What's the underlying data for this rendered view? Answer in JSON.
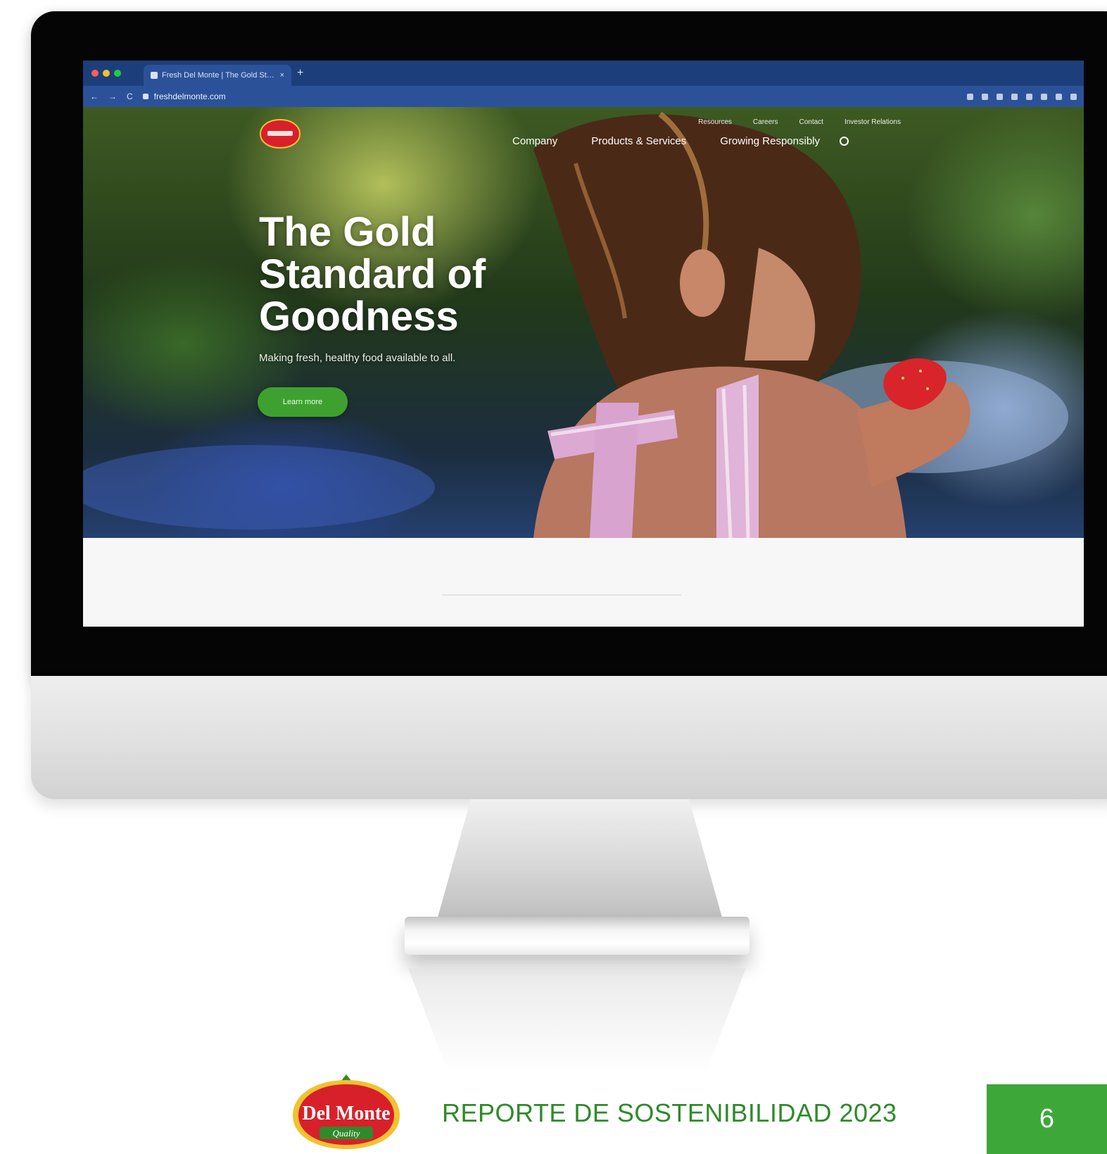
{
  "browser": {
    "tab_title": "Fresh Del Monte | The Gold Standard",
    "tab_close": "×",
    "new_tab": "+",
    "url": "freshdelmonte.com",
    "back": "←",
    "forward": "→",
    "reload": "C"
  },
  "site": {
    "utility_nav": [
      "Resources",
      "Careers",
      "Contact",
      "Investor Relations"
    ],
    "main_nav": [
      "Company",
      "Products & Services",
      "Growing Responsibly"
    ],
    "hero": {
      "title": "The Gold Standard of Goodness",
      "subtitle": "Making fresh, healthy food available to all.",
      "cta_label": "Learn more"
    }
  },
  "footer": {
    "logo": {
      "wordmark": "Del Monte",
      "tagline": "Quality"
    },
    "report_title": "REPORTE DE SOSTENIBILIDAD 2023",
    "page_number": "6"
  },
  "colors": {
    "browser_chrome": "#1c3f7c",
    "brand_green": "#3ea73a",
    "report_title_green": "#2f8a2a",
    "logo_red": "#d8202a"
  }
}
